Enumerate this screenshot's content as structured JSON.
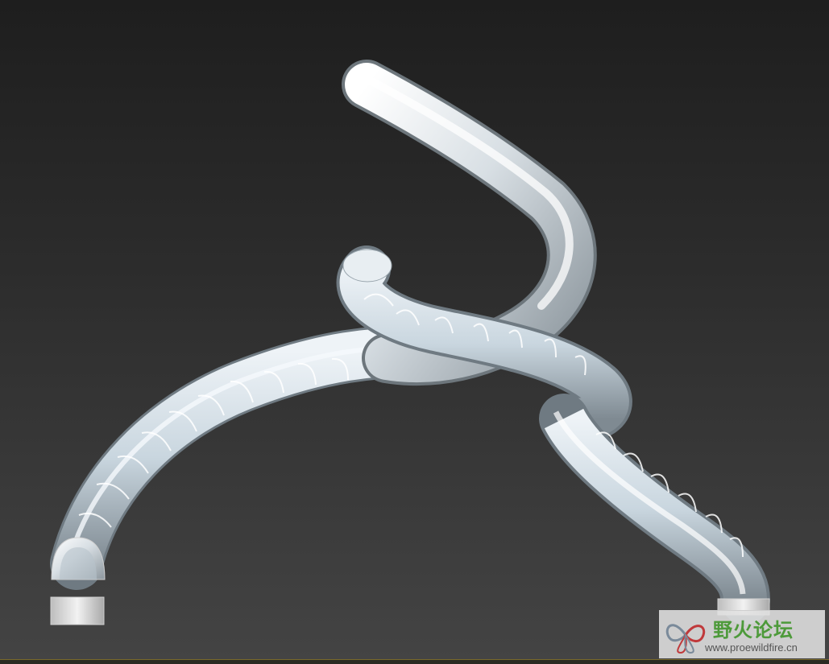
{
  "viewport": {
    "label": "3d-viewport",
    "background_top": "#1e1e1e",
    "background_bottom": "#444444"
  },
  "model": {
    "description_icon": "twisted-tube-slide-model",
    "tube_color": "#dfe6eb",
    "tube_shade": "#8e9aa2",
    "highlight_color": "#ffffff"
  },
  "watermark": {
    "title": "野火论坛",
    "url": "www.proewildfire.cn",
    "title_color": "#4d9a3a",
    "logo_icon": "butterfly-logo-icon"
  }
}
